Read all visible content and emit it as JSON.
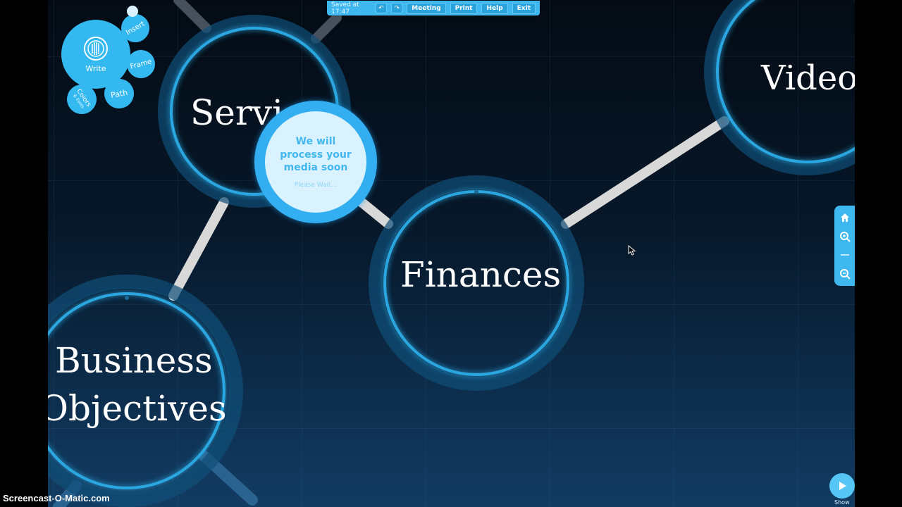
{
  "topbar": {
    "saved": "Saved at 17:47",
    "undo_icon": "undo-icon",
    "redo_icon": "redo-icon",
    "meeting": "Meeting",
    "print": "Print",
    "help": "Help",
    "exit": "Exit"
  },
  "toolbar": {
    "write": "Write",
    "insert": "Insert",
    "frame": "Frame",
    "path": "Path",
    "colors": "Colors",
    "colors_sub": "& Fonts"
  },
  "nodes": {
    "services": "Servi",
    "video": "Video",
    "finances": "Finances",
    "business_line1": "Business",
    "business_line2": "Objectives"
  },
  "processing": {
    "message_line1": "We will",
    "message_line2": "process your",
    "message_line3": "media soon",
    "wait": "Please Wait..."
  },
  "zoom": {
    "home_icon": "home-icon",
    "zoom_in_icon": "zoom-in-icon",
    "zoom_out_icon": "zoom-out-icon"
  },
  "show": {
    "label": "Show"
  },
  "watermark": "Screencast-O-Matic.com",
  "colors": {
    "accent": "#3fb8ef",
    "ring": "#2aa7e0",
    "link": "#d9d9d9"
  }
}
